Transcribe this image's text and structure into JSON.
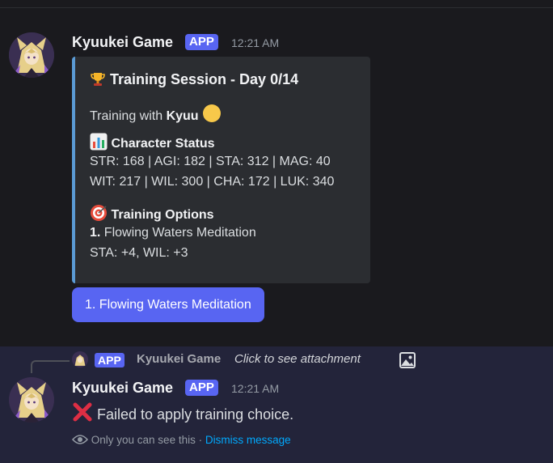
{
  "message1": {
    "author": "Kyuukei Game",
    "tag": "APP",
    "time": "12:21 AM",
    "embed": {
      "title_emoji": "trophy-icon",
      "title": "Training Session - Day 0/14",
      "training_with_prefix": "Training with ",
      "training_with_name": "Kyuu",
      "status_emoji": "bar-chart-icon",
      "status_heading": "Character Status",
      "stats_line1": "STR: 168 | AGI: 182 | STA: 312 | MAG: 40",
      "stats_line2": "WIT: 217 | WIL: 300 | CHA: 172 | LUK: 340",
      "options_emoji": "target-icon",
      "options_heading": "Training Options",
      "option_number": "1.",
      "option_name": " Flowing Waters Meditation",
      "option_effect": "STA: +4, WIL: +3",
      "accent_color": "#5b9bd5"
    },
    "button_label": "1. Flowing Waters Meditation"
  },
  "message2": {
    "reply": {
      "tag": "APP",
      "author": "Kyuukei Game",
      "text": "Click to see attachment"
    },
    "author": "Kyuukei Game",
    "tag": "APP",
    "time": "12:21 AM",
    "text": " Failed to apply training choice.",
    "note_text": "Only you can see this · ",
    "dismiss_label": "Dismiss message"
  },
  "colors": {
    "background": "#1a1a1e",
    "blurple": "#5865f2",
    "ephemeral_bg": "#23243a",
    "link": "#00a8fc"
  }
}
